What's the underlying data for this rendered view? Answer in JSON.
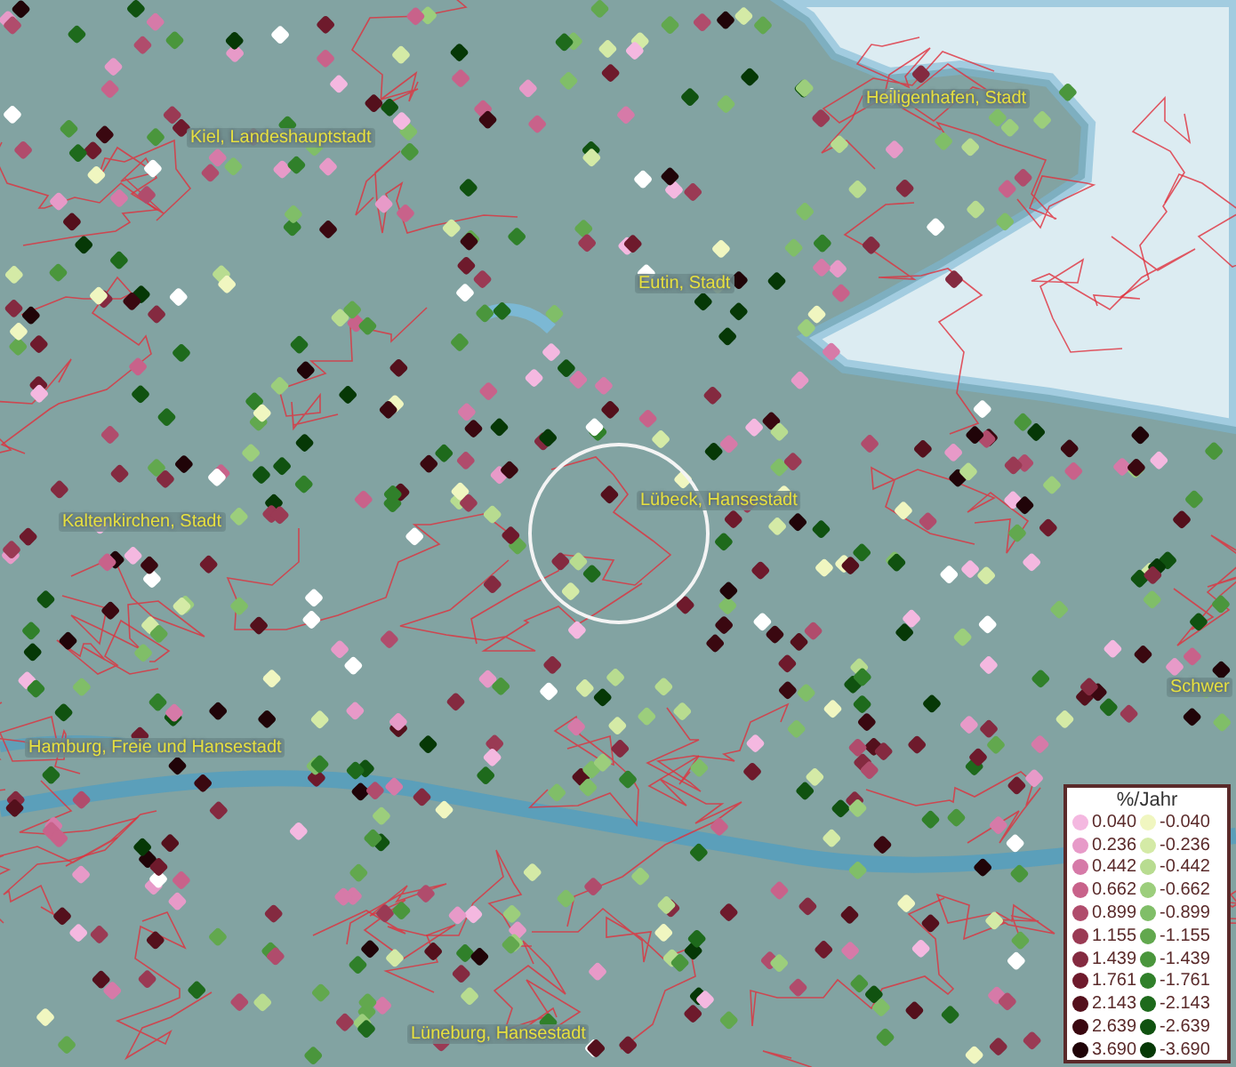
{
  "map": {
    "places": [
      {
        "name": "Heiligenhafen, Stadt"
      },
      {
        "name": "Kiel, Landeshauptstadt"
      },
      {
        "name": "Eutin, Stadt"
      },
      {
        "name": "Lübeck, Hansestadt"
      },
      {
        "name": "Kaltenkirchen, Stadt"
      },
      {
        "name": "Schwer"
      },
      {
        "name": "Hamburg, Freie und Hansestadt"
      },
      {
        "name": "Lüneburg, Hansestadt"
      }
    ]
  },
  "legend": {
    "title": "%/Jahr",
    "positive": [
      {
        "label": "0.040",
        "color": "#f4b8e0"
      },
      {
        "label": "0.236",
        "color": "#e79ac8"
      },
      {
        "label": "0.442",
        "color": "#d67aa8"
      },
      {
        "label": "0.662",
        "color": "#c8628a"
      },
      {
        "label": "0.899",
        "color": "#b04c6c"
      },
      {
        "label": "1.155",
        "color": "#9a3a54"
      },
      {
        "label": "1.439",
        "color": "#842a40"
      },
      {
        "label": "1.761",
        "color": "#6e1a2c"
      },
      {
        "label": "2.143",
        "color": "#54101c"
      },
      {
        "label": "2.639",
        "color": "#3a0810"
      },
      {
        "label": "3.690",
        "color": "#200408"
      }
    ],
    "negative": [
      {
        "label": "-0.040",
        "color": "#f0f6c0"
      },
      {
        "label": "-0.236",
        "color": "#d4eaa6"
      },
      {
        "label": "-0.442",
        "color": "#b8dc90"
      },
      {
        "label": "-0.662",
        "color": "#9cce7c"
      },
      {
        "label": "-0.899",
        "color": "#80be68"
      },
      {
        "label": "-1.155",
        "color": "#62a84e"
      },
      {
        "label": "-1.439",
        "color": "#4a963c"
      },
      {
        "label": "-1.761",
        "color": "#30802a"
      },
      {
        "label": "-2.143",
        "color": "#1e6a1c"
      },
      {
        "label": "-2.639",
        "color": "#105210"
      },
      {
        "label": "-3.690",
        "color": "#063806"
      }
    ]
  }
}
